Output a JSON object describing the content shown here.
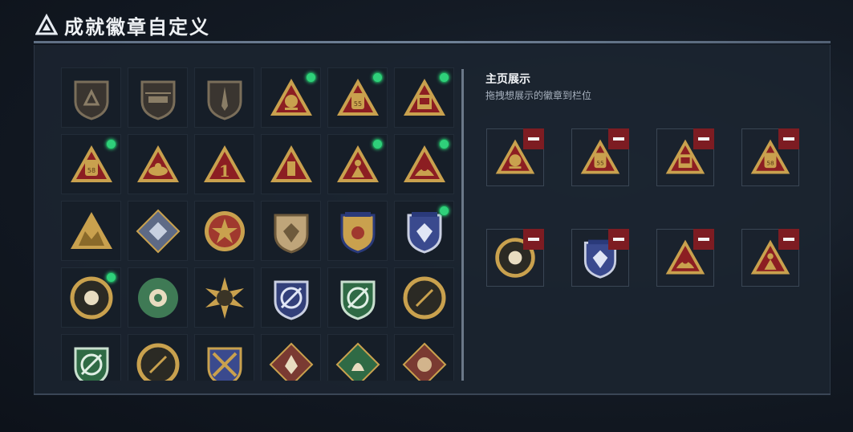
{
  "header": {
    "title": "成就徽章自定义"
  },
  "showcase": {
    "title": "主页展示",
    "subtitle": "拖拽想展示的徽章到栏位",
    "slots": [
      {
        "badge": "gold-triangle-badge-eagle",
        "color": "#8c1e22"
      },
      {
        "badge": "gold-triangle-badge-pack-55",
        "color": "#8c1e22",
        "text": "55"
      },
      {
        "badge": "gold-triangle-badge-crate",
        "color": "#8c1e22"
      },
      {
        "badge": "gold-triangle-badge-pack-58",
        "color": "#8c1e22",
        "text": "58"
      },
      {
        "badge": "gold-round-badge-orb",
        "color": "#8c1e22"
      },
      {
        "badge": "blue-shield-badge-diamond",
        "color": "#2a3a7a"
      },
      {
        "badge": "gold-triangle-badge-hands",
        "color": "#8c1e22"
      },
      {
        "badge": "gold-triangle-badge-runner",
        "color": "#8c1e22"
      }
    ]
  },
  "badges": [
    {
      "kind": "shield-outline",
      "new": false
    },
    {
      "kind": "heli",
      "new": false
    },
    {
      "kind": "shield-dagger",
      "new": false
    },
    {
      "kind": "tri-eagle",
      "new": true
    },
    {
      "kind": "tri-pack",
      "text": "55",
      "new": true
    },
    {
      "kind": "tri-crate",
      "new": true
    },
    {
      "kind": "tri-pack",
      "text": "58",
      "new": true
    },
    {
      "kind": "tri-bowl",
      "new": false
    },
    {
      "kind": "tri-one",
      "text": "1",
      "new": false
    },
    {
      "kind": "tri-cylinder",
      "new": false
    },
    {
      "kind": "tri-runner",
      "new": true
    },
    {
      "kind": "tri-hands",
      "new": true
    },
    {
      "kind": "tri-squad",
      "new": false
    },
    {
      "kind": "diamond-cube",
      "new": false
    },
    {
      "kind": "star-medal",
      "new": false
    },
    {
      "kind": "shield-cream",
      "new": false
    },
    {
      "kind": "shield-stars",
      "new": false
    },
    {
      "kind": "blue-shield",
      "new": true
    },
    {
      "kind": "round-orb",
      "new": true
    },
    {
      "kind": "round-rose",
      "new": false
    },
    {
      "kind": "sun-medal",
      "new": false
    },
    {
      "kind": "shield-blue-gun",
      "new": false
    },
    {
      "kind": "shield-green-gun",
      "new": false
    },
    {
      "kind": "round-slash",
      "new": false
    },
    {
      "kind": "shield-green-gun-2",
      "new": false
    },
    {
      "kind": "round-slash-2",
      "new": false
    },
    {
      "kind": "shield-gold-cross",
      "new": false
    },
    {
      "kind": "wolf-diamond",
      "new": false
    },
    {
      "kind": "dragon-diamond",
      "new": false
    },
    {
      "kind": "beast-diamond",
      "new": false
    }
  ]
}
